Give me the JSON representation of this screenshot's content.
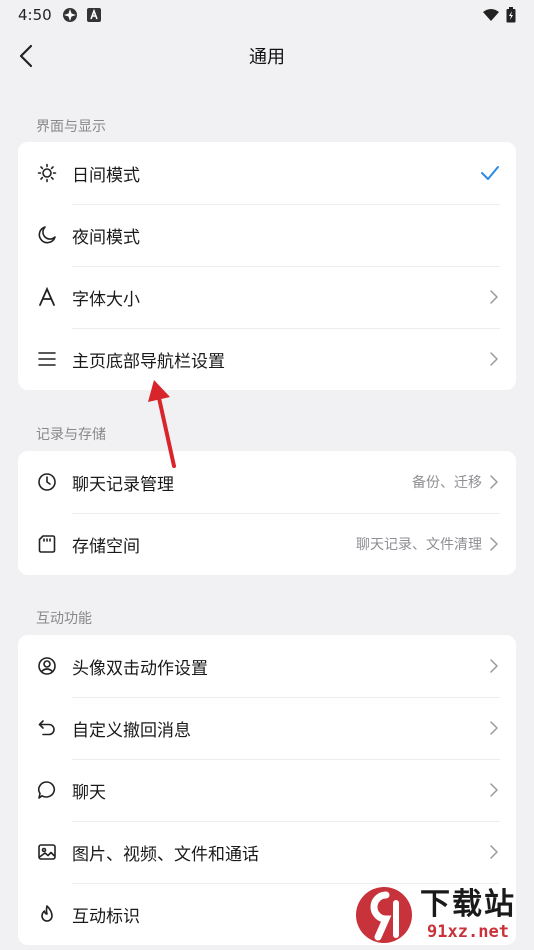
{
  "status_bar": {
    "time": "4:50"
  },
  "header": {
    "title": "通用"
  },
  "sections": [
    {
      "label": "界面与显示",
      "items": [
        {
          "label": "日间模式",
          "icon": "sun-icon",
          "checked": true
        },
        {
          "label": "夜间模式",
          "icon": "moon-icon"
        },
        {
          "label": "字体大小",
          "icon": "font-size-icon"
        },
        {
          "label": "主页底部导航栏设置",
          "icon": "menu-icon"
        }
      ]
    },
    {
      "label": "记录与存储",
      "items": [
        {
          "label": "聊天记录管理",
          "icon": "clock-icon",
          "sub": "备份、迁移"
        },
        {
          "label": "存储空间",
          "icon": "sd-card-icon",
          "sub": "聊天记录、文件清理"
        }
      ]
    },
    {
      "label": "互动功能",
      "items": [
        {
          "label": "头像双击动作设置",
          "icon": "avatar-icon"
        },
        {
          "label": "自定义撤回消息",
          "icon": "undo-icon"
        },
        {
          "label": "聊天",
          "icon": "chat-bubble-icon"
        },
        {
          "label": "图片、视频、文件和通话",
          "icon": "image-icon"
        },
        {
          "label": "互动标识",
          "icon": "flame-icon"
        }
      ]
    }
  ],
  "colors": {
    "accent": "#2b8ae6",
    "background": "#f1f1f4",
    "annotation": "#d8242b"
  },
  "watermark": {
    "cn": "下载站",
    "url": "91xz.net"
  }
}
